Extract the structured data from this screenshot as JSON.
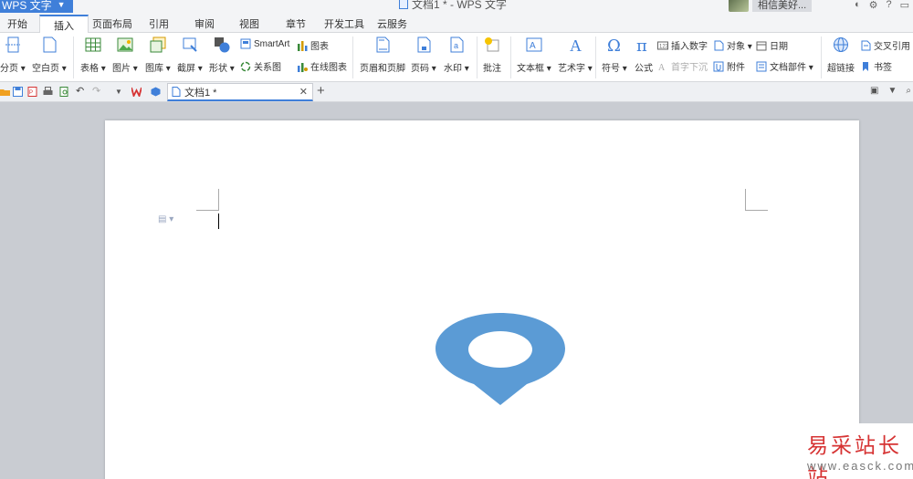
{
  "app": {
    "menu_label": "WPS 文字",
    "window_title": "文档1 * - WPS 文字",
    "user_name": "相信美好..."
  },
  "menu_tabs": [
    "开始",
    "插入",
    "页面布局",
    "引用",
    "审阅",
    "视图",
    "章节",
    "开发工具",
    "云服务"
  ],
  "active_tab": "插入",
  "ribbon": {
    "page_break": "分页",
    "blank_page": "空白页",
    "table": "表格",
    "picture": "图片",
    "gallery": "图库",
    "screenshot": "截屏",
    "shapes": "形状",
    "smartart": "SmartArt",
    "chart": "图表",
    "relation_chart": "关系图",
    "online_chart": "在线图表",
    "header_footer": "页眉和页脚",
    "page_number": "页码",
    "watermark": "水印",
    "comment": "批注",
    "textbox": "文本框",
    "wordart": "艺术字",
    "symbol": "符号",
    "formula": "公式",
    "insert_number": "插入数字",
    "drop_cap": "首字下沉",
    "object": "对象",
    "attachment": "附件",
    "date": "日期",
    "doc_parts": "文档部件",
    "hyperlink": "超链接",
    "cross_ref": "交叉引用",
    "bookmark": "书签"
  },
  "doc_tabs": [
    {
      "label": "文档1 *",
      "active": true
    }
  ],
  "colors": {
    "accent": "#3f7fd9",
    "pin": "#5b9bd5"
  },
  "watermark": {
    "title": "易采站长站",
    "url": "www.easck.com"
  }
}
